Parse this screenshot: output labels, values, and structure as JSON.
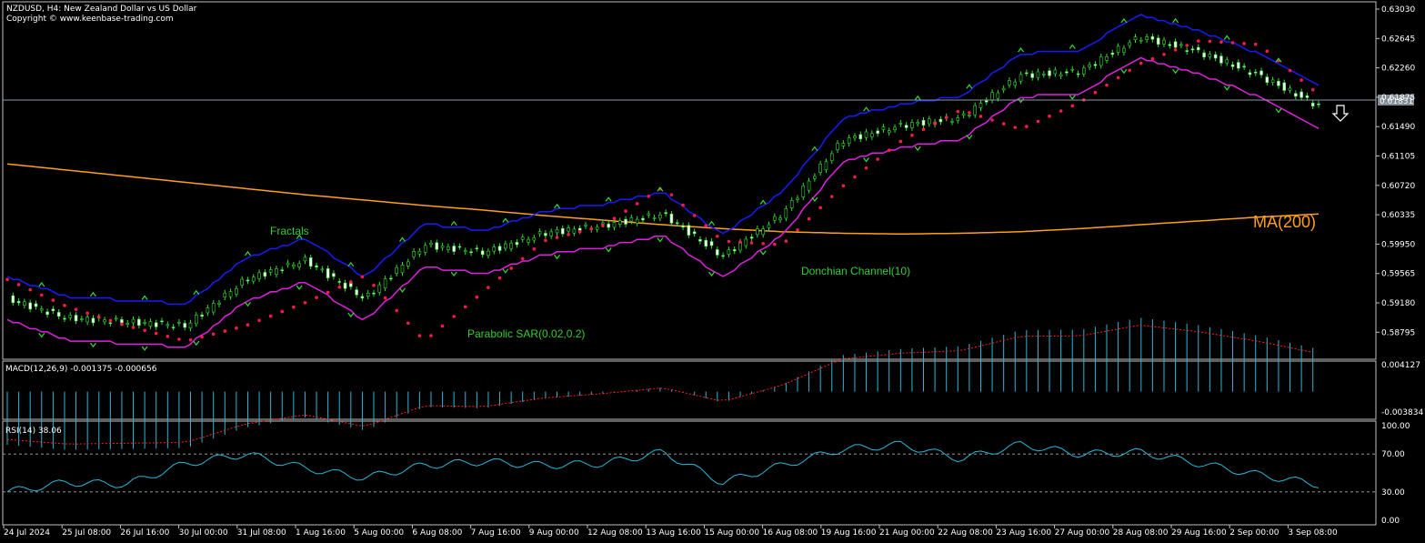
{
  "header": {
    "symbol_line": "NZDUSD, H4:  New Zealand Dollar vs US Dollar",
    "copyright": "Copyright © www.keenbase-trading.com"
  },
  "price_axis": {
    "ticks": [
      "0.63030",
      "0.62645",
      "0.62260",
      "0.61875",
      "0.61490",
      "0.61105",
      "0.60720",
      "0.60335",
      "0.59950",
      "0.59565",
      "0.59180",
      "0.58795"
    ],
    "current_price": "0.61831",
    "ylim": [
      0.586,
      0.6318
    ]
  },
  "time_axis": {
    "ticks": [
      "24 Jul 2024",
      "25 Jul 08:00",
      "26 Jul 16:00",
      "30 Jul 00:00",
      "31 Jul 08:00",
      "1 Aug 16:00",
      "5 Aug 00:00",
      "6 Aug 08:00",
      "7 Aug 16:00",
      "9 Aug 00:00",
      "12 Aug 08:00",
      "13 Aug 16:00",
      "15 Aug 00:00",
      "16 Aug 08:00",
      "19 Aug 16:00",
      "21 Aug 00:00",
      "22 Aug 08:00",
      "23 Aug 16:00",
      "27 Aug 00:00",
      "28 Aug 08:00",
      "29 Aug 16:00",
      "2 Sep 00:00",
      "3 Sep 08:00"
    ]
  },
  "annotations": {
    "fractals": "Fractals",
    "parabolic_sar": "Parabolic SAR(0.02,0.2)",
    "donchian": "Donchian Channel(10)",
    "ma": "MA(200)"
  },
  "macd": {
    "title": "MACD(12,26,9) -0.001375 -0.000656",
    "ticks": [
      "0.004127",
      "-0.003834"
    ],
    "ylim": [
      -0.003834,
      0.004127
    ]
  },
  "rsi": {
    "title": "RSI(14) 38.06",
    "ticks": [
      "100.00",
      "70.00",
      "30.00",
      "0.00"
    ],
    "ylim": [
      0,
      100
    ],
    "levels": [
      70,
      30
    ]
  },
  "colors": {
    "up_candle": "#ffffff",
    "down_candle": "#ffffff",
    "candle_wick": "#33dd33",
    "donchian_upper": "#1a1aff",
    "donchian_lower": "#e020e0",
    "ma200": "#ff9f1a",
    "sar": "#ff1a4a",
    "macd_hist": "#28b8d8",
    "macd_signal": "#ff2020",
    "rsi": "#28b8d8",
    "grid": "#c0c0c0"
  },
  "chart_data": {
    "type": "line",
    "series": [
      {
        "name": "MA(200)",
        "values": [
          0.611,
          0.6102,
          0.6094,
          0.6086,
          0.6078,
          0.607,
          0.6063,
          0.6056,
          0.605,
          0.6043,
          0.6037,
          0.6031,
          0.6026,
          0.6022,
          0.602,
          0.6019,
          0.602,
          0.6022,
          0.6026,
          0.6031,
          0.6036,
          0.6041,
          0.6045
        ]
      },
      {
        "name": "Donchian Channel(10)",
        "values": [
          0.599,
          0.5935,
          0.592,
          0.591,
          0.594,
          0.5975,
          0.598,
          0.5975,
          0.6025,
          0.603,
          0.6025,
          0.608,
          0.604,
          0.608,
          0.616,
          0.618,
          0.6183,
          0.624,
          0.6255,
          0.6285,
          0.63,
          0.627,
          0.624
        ]
      },
      {
        "name": "Parabolic SAR(0.02,0.2)",
        "values": [
          0.596,
          0.5925,
          0.59,
          0.588,
          0.59,
          0.593,
          0.5965,
          0.588,
          0.5945,
          0.601,
          0.603,
          0.608,
          0.601,
          0.6005,
          0.608,
          0.614,
          0.618,
          0.6155,
          0.619,
          0.624,
          0.627,
          0.6265,
          0.62
        ]
      },
      {
        "name": "RSI(14)",
        "values": [
          30,
          40,
          38,
          60,
          70,
          55,
          45,
          58,
          62,
          58,
          60,
          72,
          40,
          58,
          75,
          80,
          65,
          80,
          70,
          72,
          60,
          48,
          38
        ]
      }
    ],
    "x": [
      "24 Jul 2024",
      "25 Jul 08:00",
      "26 Jul 16:00",
      "30 Jul 00:00",
      "31 Jul 08:00",
      "1 Aug 16:00",
      "5 Aug 00:00",
      "6 Aug 08:00",
      "7 Aug 16:00",
      "9 Aug 00:00",
      "12 Aug 08:00",
      "13 Aug 16:00",
      "15 Aug 00:00",
      "16 Aug 08:00",
      "19 Aug 16:00",
      "21 Aug 00:00",
      "22 Aug 08:00",
      "23 Aug 16:00",
      "27 Aug 00:00",
      "28 Aug 08:00",
      "29 Aug 16:00",
      "2 Sep 00:00",
      "3 Sep 08:00"
    ],
    "close": [
      0.5935,
      0.591,
      0.5905,
      0.59,
      0.596,
      0.5985,
      0.5935,
      0.6005,
      0.5995,
      0.602,
      0.603,
      0.6045,
      0.599,
      0.6045,
      0.614,
      0.616,
      0.617,
      0.6225,
      0.623,
      0.6275,
      0.6255,
      0.6225,
      0.6185
    ],
    "ylim": [
      0.586,
      0.6318
    ],
    "grid": false
  }
}
